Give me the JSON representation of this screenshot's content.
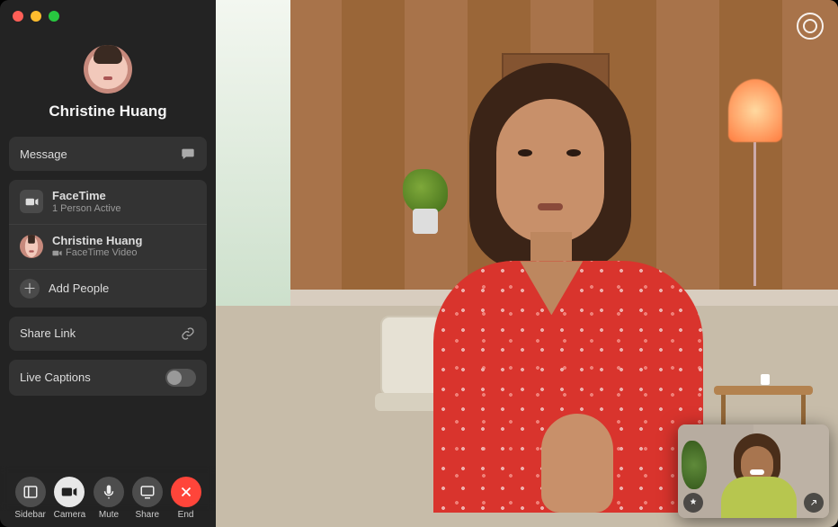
{
  "contact": {
    "name": "Christine Huang"
  },
  "sidebar": {
    "message_label": "Message",
    "facetime": {
      "title": "FaceTime",
      "subtitle": "1 Person Active"
    },
    "participant": {
      "name": "Christine Huang",
      "status": "FaceTime Video"
    },
    "add_people_label": "Add People",
    "share_link_label": "Share Link",
    "live_captions_label": "Live Captions",
    "live_captions_on": false
  },
  "controls": {
    "sidebar": "Sidebar",
    "camera": "Camera",
    "mute": "Mute",
    "share": "Share",
    "end": "End"
  },
  "pip": {
    "effects_label": "Effects",
    "expand_label": "Expand"
  }
}
